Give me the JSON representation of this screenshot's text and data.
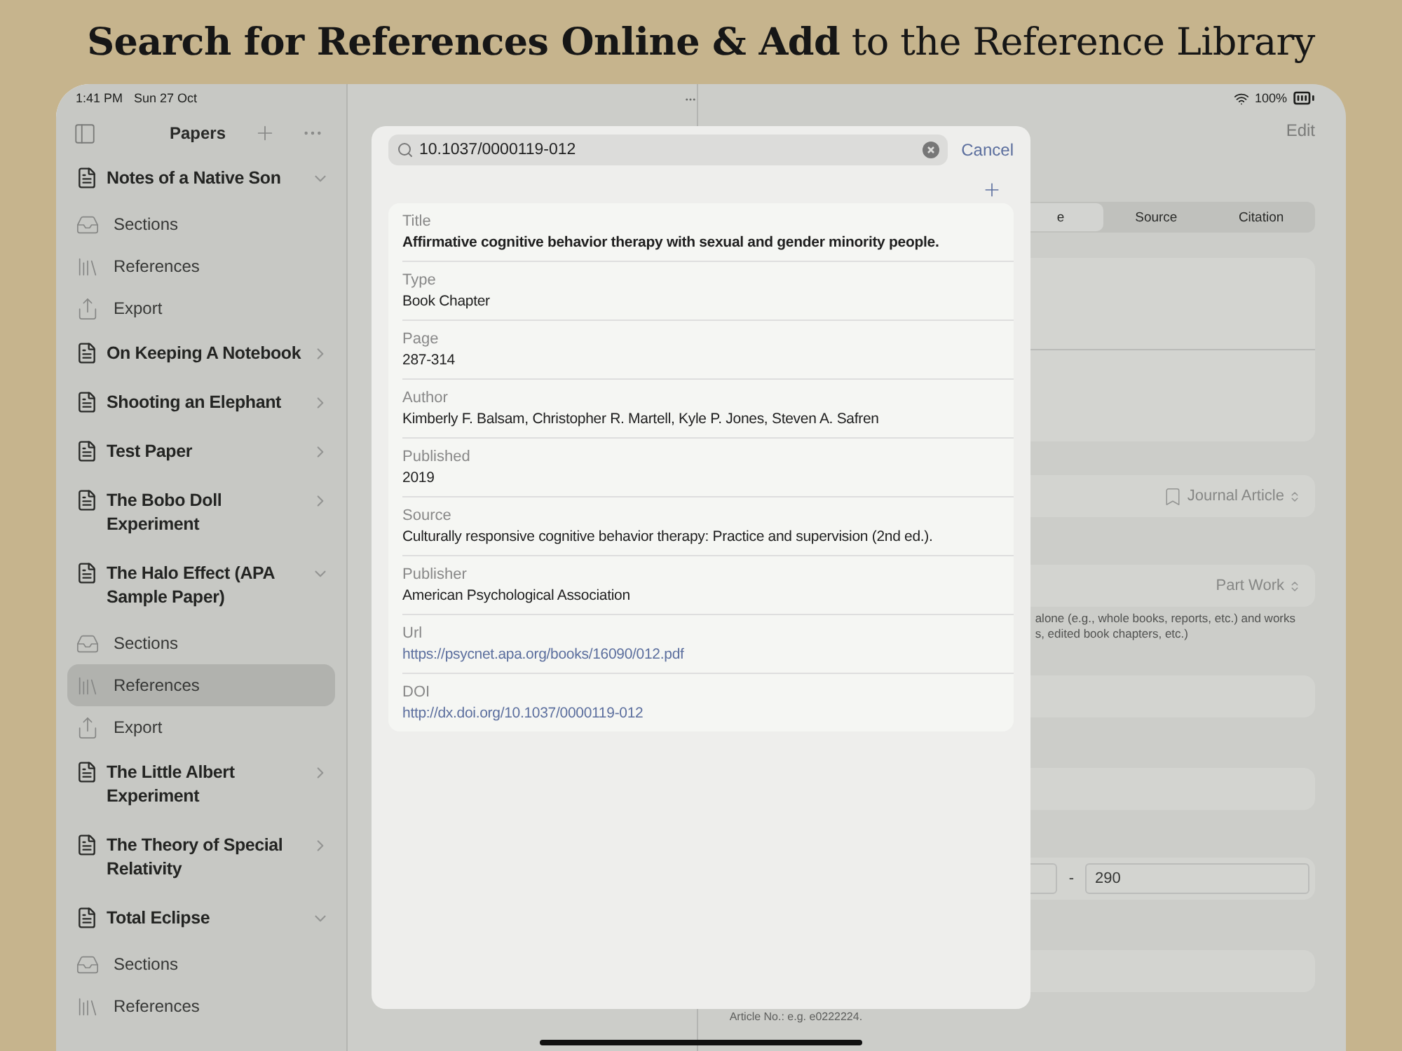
{
  "banner": {
    "headline": "**Search for References Online & Add** to the Reference Library"
  },
  "status_bar": {
    "time": "1:41 PM",
    "date": "Sun 27 Oct",
    "battery": "100%"
  },
  "sidebar": {
    "title": "Papers",
    "papers": [
      {
        "title": "Notes of a Native Son",
        "expanded": true,
        "children": [
          {
            "label": "Sections",
            "kind": "sections",
            "selected": false
          },
          {
            "label": "References",
            "kind": "references",
            "selected": false
          },
          {
            "label": "Export",
            "kind": "export",
            "selected": false
          }
        ]
      },
      {
        "title": "On Keeping A Notebook",
        "expanded": false
      },
      {
        "title": "Shooting an Elephant",
        "expanded": false
      },
      {
        "title": "Test Paper",
        "expanded": false
      },
      {
        "title": "The Bobo Doll Experiment",
        "expanded": false
      },
      {
        "title": "The Halo Effect (APA Sample Paper)",
        "expanded": true,
        "children": [
          {
            "label": "Sections",
            "kind": "sections",
            "selected": false
          },
          {
            "label": "References",
            "kind": "references",
            "selected": true
          },
          {
            "label": "Export",
            "kind": "export",
            "selected": false
          }
        ]
      },
      {
        "title": "The Little Albert Experiment",
        "expanded": false
      },
      {
        "title": "The Theory of Special Relativity",
        "expanded": false
      },
      {
        "title": "Total Eclipse",
        "expanded": true,
        "children": [
          {
            "label": "Sections",
            "kind": "sections",
            "selected": false
          },
          {
            "label": "References",
            "kind": "references",
            "selected": false
          }
        ]
      }
    ]
  },
  "editor": {
    "edit": "Edit",
    "segments": [
      {
        "label": "e",
        "selected": true
      },
      {
        "label": "Source",
        "selected": false
      },
      {
        "label": "Citation",
        "selected": false
      }
    ],
    "type_value": "Journal Article",
    "work_value": "Part Work",
    "helper_lines": [
      "alone (e.g., whole books, reports, etc.) and works",
      "s, edited book chapters, etc.)"
    ],
    "page_separator": "-",
    "page_end": "290",
    "article_hint": "Article No.: e.g. e0222224."
  },
  "search_sheet": {
    "query": "10.1037/0000119-012",
    "cancel": "Cancel",
    "fields": [
      {
        "label": "Title",
        "value": "Affirmative cognitive behavior therapy with sexual and gender minority people.",
        "kind": "bold"
      },
      {
        "label": "Type",
        "value": "Book Chapter",
        "kind": "plain"
      },
      {
        "label": "Page",
        "value": "287-314",
        "kind": "plain"
      },
      {
        "label": "Author",
        "value": "Kimberly F. Balsam, Christopher R. Martell, Kyle P. Jones, Steven A. Safren",
        "kind": "plain"
      },
      {
        "label": "Published",
        "value": "2019",
        "kind": "plain"
      },
      {
        "label": "Source",
        "value": "Culturally responsive cognitive behavior therapy: Practice and supervision (2nd ed.).",
        "kind": "plain"
      },
      {
        "label": "Publisher",
        "value": "American Psychological Association",
        "kind": "plain"
      },
      {
        "label": "Url",
        "value": "https://psycnet.apa.org/books/16090/012.pdf",
        "kind": "link"
      },
      {
        "label": "DOI",
        "value": "http://dx.doi.org/10.1037/0000119-012",
        "kind": "link"
      }
    ]
  }
}
